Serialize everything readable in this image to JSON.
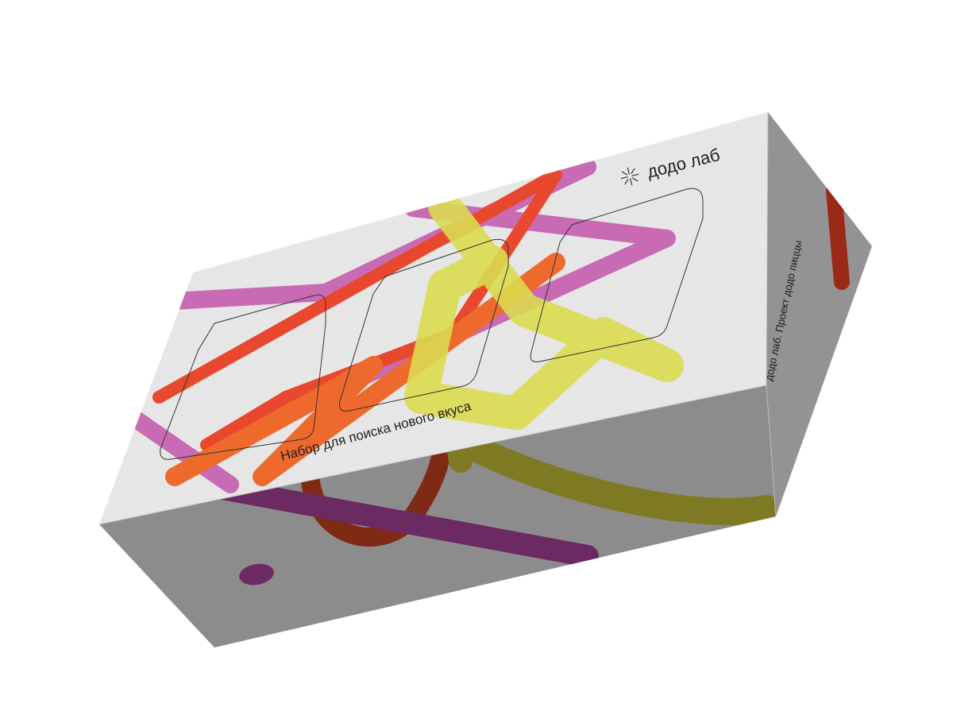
{
  "product": {
    "brand_name": "додо лаб",
    "tagline": "Набор для поиска нового вкуса",
    "side_text": "додо лаб. Проект додо пиццы"
  },
  "colors": {
    "background": "#ffffff",
    "box_top": "#e6e6e6",
    "box_front": "#8c8c8c",
    "box_side": "#939393",
    "magenta": "#c86bb4",
    "orange": "#ee6a2c",
    "red_orange": "#e8492e",
    "yellow": "#dada50",
    "text_dark": "#222222"
  },
  "icons": {
    "logo": "sparkle-logo-icon"
  }
}
